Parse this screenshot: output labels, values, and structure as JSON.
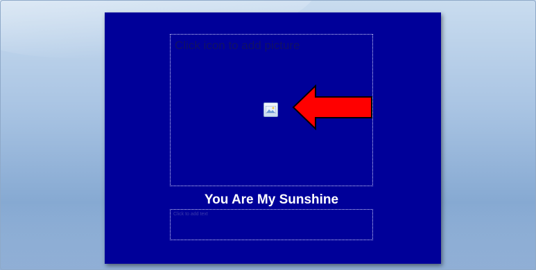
{
  "slide": {
    "title": "You Are My Sunshine",
    "picture_placeholder": {
      "prompt": "Click icon to add picture",
      "icon": "insert-picture-icon"
    },
    "caption_placeholder": {
      "prompt": "Click to add text"
    },
    "annotation_arrow": {
      "icon": "left-arrow-callout",
      "fill_color": "#ff0000",
      "stroke_color": "#000000"
    },
    "background_color": "#000099"
  }
}
